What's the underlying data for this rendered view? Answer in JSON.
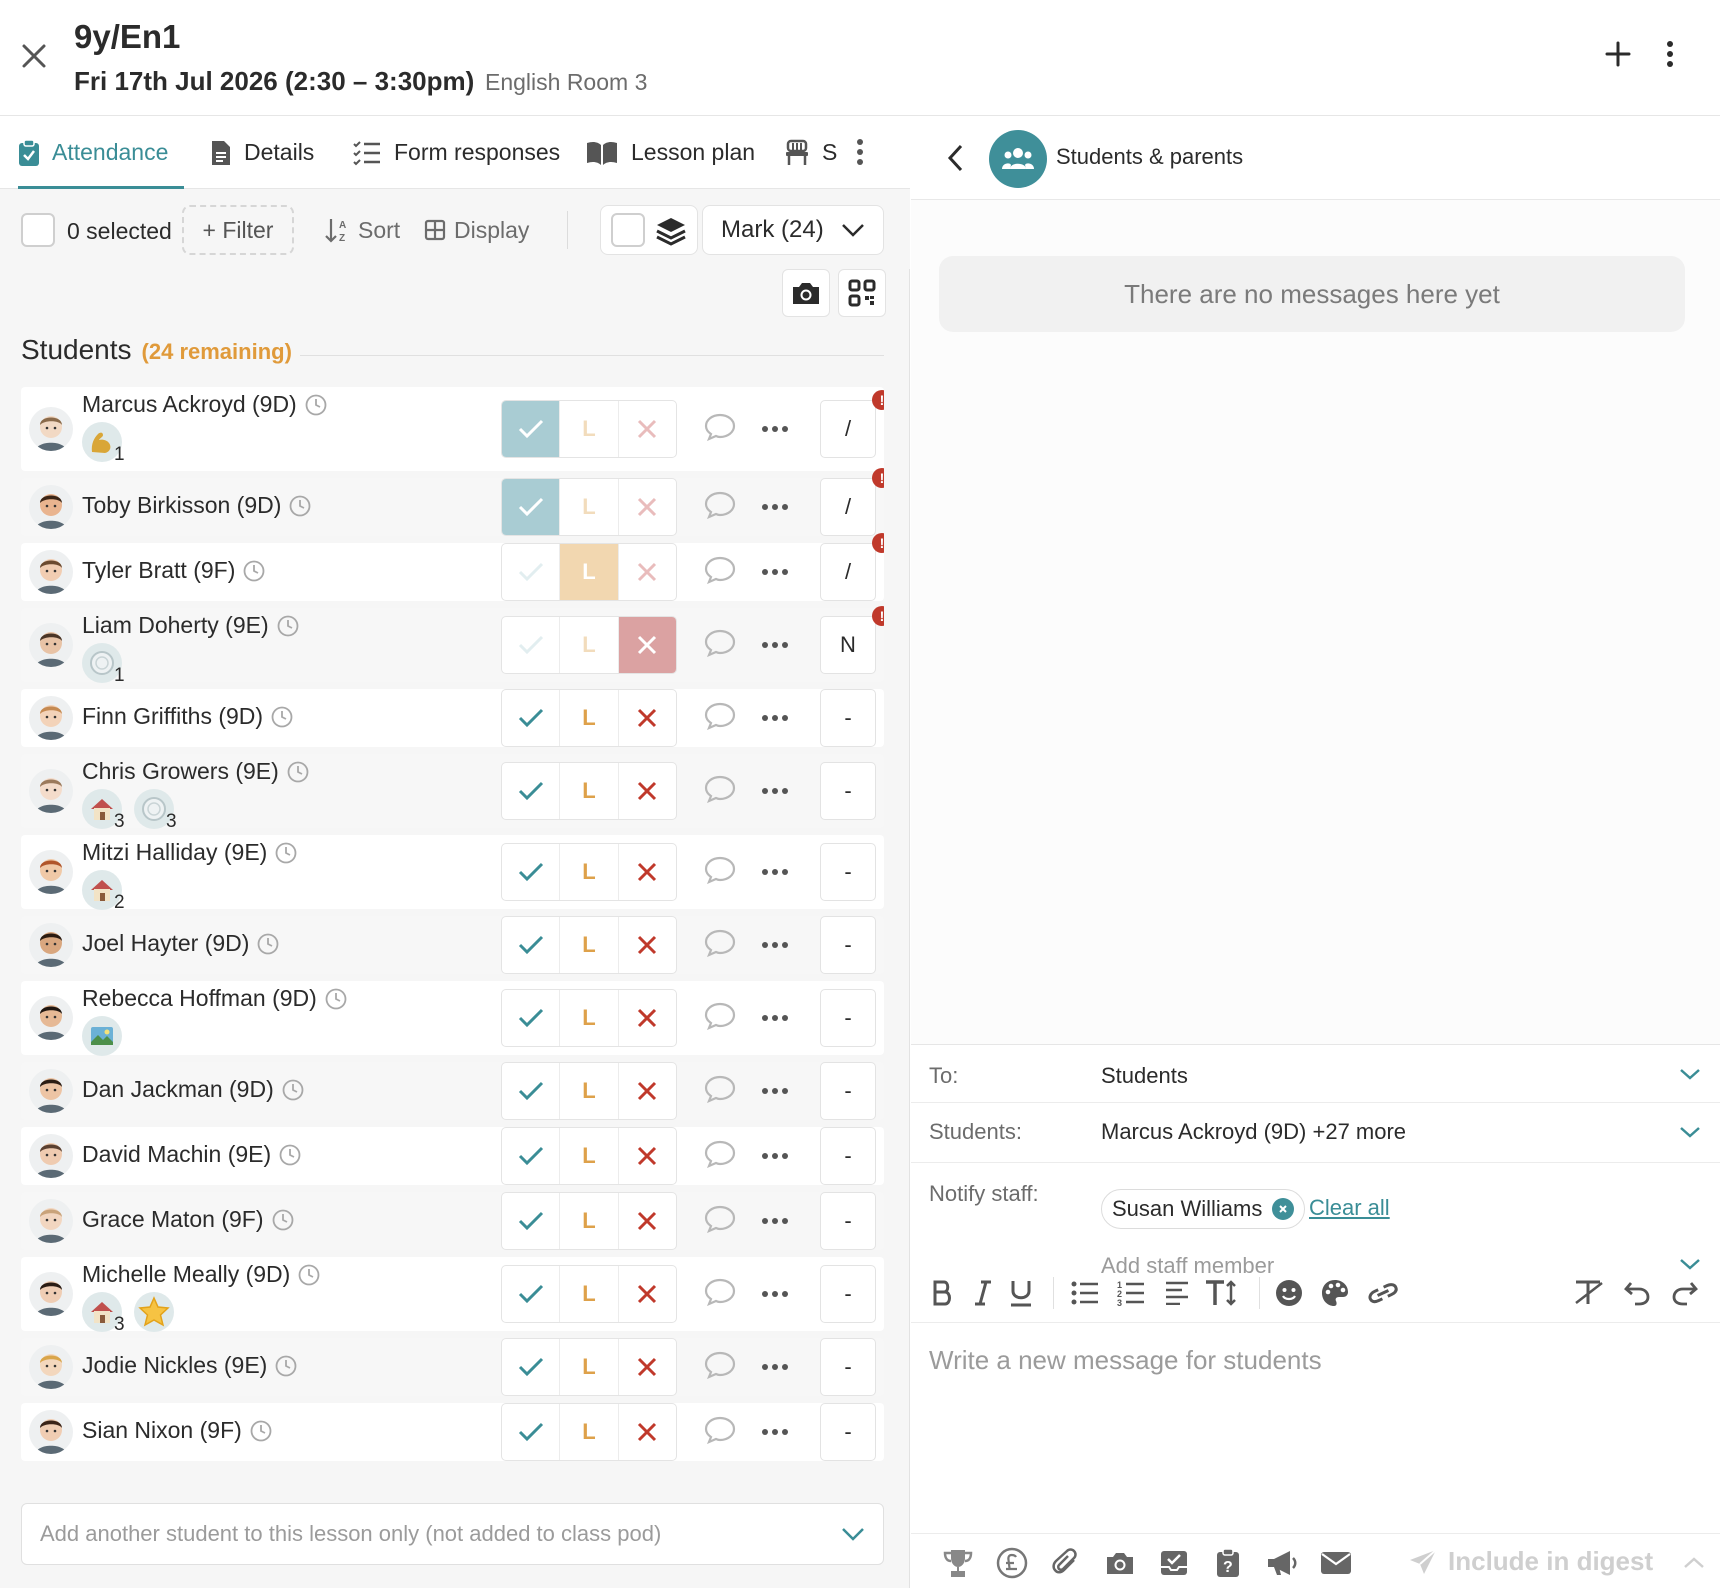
{
  "header": {
    "title": "9y/En1",
    "datetime": "Fri 17th Jul 2026 (2:30 – 3:30pm)",
    "room": "English Room 3"
  },
  "tabs": [
    {
      "label": "Attendance",
      "icon": "clipboard-check-icon",
      "active": true
    },
    {
      "label": "Details",
      "icon": "document-icon"
    },
    {
      "label": "Form responses",
      "icon": "list-check-icon"
    },
    {
      "label": "Lesson plan",
      "icon": "book-open-icon"
    },
    {
      "label": "S",
      "icon": "chair-icon"
    }
  ],
  "toolbar": {
    "selected": "0 selected",
    "filter": "+ Filter",
    "sort": "Sort",
    "display": "Display",
    "mark": "Mark (24)"
  },
  "section": {
    "title": "Students",
    "remaining": "(24 remaining)"
  },
  "mark_labels": {
    "late": "L"
  },
  "students": [
    {
      "name": "Marcus Ackroyd (9D)",
      "mark": "present",
      "code": "/",
      "alert": true,
      "badges": [
        {
          "icon": "bicep-icon",
          "count": "1"
        }
      ],
      "skin": "#f2d9c4",
      "hair": "#8a6a4a"
    },
    {
      "name": "Toby Birkisson (9D)",
      "mark": "present",
      "code": "/",
      "alert": true,
      "badges": [],
      "skin": "#e9b48f",
      "hair": "#3b2516"
    },
    {
      "name": "Tyler Bratt (9F)",
      "mark": "late",
      "code": "/",
      "alert": true,
      "badges": [],
      "skin": "#f1cdb2",
      "hair": "#6b4a2f"
    },
    {
      "name": "Liam Doherty (9E)",
      "mark": "absent",
      "code": "N",
      "alert": true,
      "badges": [
        {
          "icon": "plate-icon",
          "count": "1"
        }
      ],
      "skin": "#e8c3a6",
      "hair": "#4a3526"
    },
    {
      "name": "Finn Griffiths (9D)",
      "mark": "none",
      "code": "-",
      "alert": false,
      "badges": [],
      "skin": "#f3d3b9",
      "hair": "#c58a52"
    },
    {
      "name": "Chris Growers (9E)",
      "mark": "none",
      "code": "-",
      "alert": false,
      "badges": [
        {
          "icon": "house-icon",
          "count": "3"
        },
        {
          "icon": "plate-icon",
          "count": "3"
        }
      ],
      "skin": "#f4dccb",
      "hair": "#9b7a5c"
    },
    {
      "name": "Mitzi Halliday (9E)",
      "mark": "none",
      "code": "-",
      "alert": false,
      "badges": [
        {
          "icon": "house-icon",
          "count": "2"
        }
      ],
      "skin": "#f0c9a7",
      "hair": "#b0552a"
    },
    {
      "name": "Joel Hayter (9D)",
      "mark": "none",
      "code": "-",
      "alert": false,
      "badges": [],
      "skin": "#d9a77f",
      "hair": "#2a1a10"
    },
    {
      "name": "Rebecca Hoffman (9D)",
      "mark": "none",
      "code": "-",
      "alert": false,
      "badges": [
        {
          "icon": "picture-icon",
          "count": ""
        }
      ],
      "skin": "#e6b995",
      "hair": "#1e1510"
    },
    {
      "name": "Dan Jackman (9D)",
      "mark": "none",
      "code": "-",
      "alert": false,
      "badges": [],
      "skin": "#edc4a4",
      "hair": "#2b1d14"
    },
    {
      "name": "David Machin (9E)",
      "mark": "none",
      "code": "-",
      "alert": false,
      "badges": [],
      "skin": "#efcbb0",
      "hair": "#5a4030"
    },
    {
      "name": "Grace Maton (9F)",
      "mark": "none",
      "code": "-",
      "alert": false,
      "badges": [],
      "skin": "#f2d6c0",
      "hair": "#c9a37a"
    },
    {
      "name": "Michelle Meally (9D)",
      "mark": "none",
      "code": "-",
      "alert": false,
      "badges": [
        {
          "icon": "house-icon",
          "count": "3"
        },
        {
          "icon": "star-icon",
          "count": ""
        }
      ],
      "skin": "#efcdb4",
      "hair": "#2a1c14"
    },
    {
      "name": "Jodie Nickles (9E)",
      "mark": "none",
      "code": "-",
      "alert": false,
      "badges": [],
      "skin": "#f3d7bd",
      "hair": "#d9a54a"
    },
    {
      "name": "Sian Nixon (9F)",
      "mark": "none",
      "code": "-",
      "alert": false,
      "badges": [],
      "skin": "#f0cdb3",
      "hair": "#3a2418"
    }
  ],
  "add_student_placeholder": "Add another student to this lesson only (not added to class pod)",
  "messages": {
    "title": "Students & parents",
    "empty": "There are no messages here yet",
    "to_label": "To:",
    "to_value": "Students",
    "students_label": "Students:",
    "students_value": "Marcus Ackroyd (9D) +27 more",
    "notify_label": "Notify staff:",
    "notify_chip": "Susan Williams",
    "clear_all": "Clear all",
    "add_staff": "Add staff member",
    "placeholder": "Write a new message for students",
    "digest": "Include in digest"
  },
  "colors": {
    "accent": "#3a8d96",
    "present": "#a9ccd3",
    "late": "#f2d7b0",
    "absent": "#dba2a2",
    "alert": "#c0392b",
    "remaining": "#e09a3a"
  }
}
